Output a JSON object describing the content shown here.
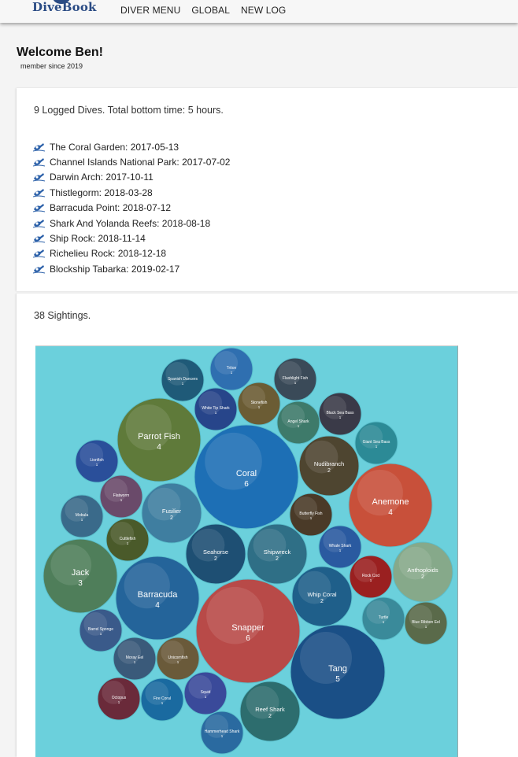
{
  "brand": {
    "name": "DiveBook"
  },
  "nav": {
    "items": [
      "DIVER MENU",
      "GLOBAL",
      "NEW LOG"
    ]
  },
  "welcome": {
    "title": "Welcome Ben!",
    "member_since": "member since 2019"
  },
  "dives": {
    "summary": "9 Logged Dives. Total bottom time: 5 hours.",
    "items": [
      "The Coral Garden: 2017-05-13",
      "Channel Islands National Park: 2017-07-02",
      "Darwin Arch: 2017-10-11",
      "Thistlegorm: 2018-03-28",
      "Barracuda Point: 2018-07-12",
      "Shark And Yolanda Reefs: 2018-08-18",
      "Ship Rock: 2018-11-14",
      "Richelieu Rock: 2018-12-18",
      "Blockship Tabarka: 2019-02-17"
    ]
  },
  "sightings": {
    "summary": "38 Sightings.",
    "background": "#6bd0dc",
    "bubbles": [
      {
        "name": "Coral",
        "count": 6,
        "color": "#1d6fb5"
      },
      {
        "name": "Snapper",
        "count": 6,
        "color": "#b84a48"
      },
      {
        "name": "Tang",
        "count": 5,
        "color": "#1a4f86"
      },
      {
        "name": "Parrot Fish",
        "count": 4,
        "color": "#5f7a3a"
      },
      {
        "name": "Barracuda",
        "count": 4,
        "color": "#24649a"
      },
      {
        "name": "Anemone",
        "count": 4,
        "color": "#c8503a"
      },
      {
        "name": "Jack",
        "count": 3,
        "color": "#4f7e5a"
      },
      {
        "name": "Fusilier",
        "count": 2,
        "color": "#3f7ea0"
      },
      {
        "name": "Nudibranch",
        "count": 2,
        "color": "#4e4530"
      },
      {
        "name": "Seahorse",
        "count": 2,
        "color": "#1e4f73"
      },
      {
        "name": "Shipwreck",
        "count": 2,
        "color": "#2f6f86"
      },
      {
        "name": "Whip Coral",
        "count": 2,
        "color": "#1f5f8a"
      },
      {
        "name": "Anthoploids",
        "count": 2,
        "color": "#86a98a"
      },
      {
        "name": "Reef Shark",
        "count": 2,
        "color": "#2d6d6e"
      },
      {
        "name": "Spanish Dancers",
        "count": 1,
        "color": "#1f5a78"
      },
      {
        "name": "Triton",
        "count": 1,
        "color": "#2f6fb0"
      },
      {
        "name": "Flashlight Fish",
        "count": 1,
        "color": "#3a4a58"
      },
      {
        "name": "White Tip Shark",
        "count": 1,
        "color": "#27458a"
      },
      {
        "name": "Stonefish",
        "count": 1,
        "color": "#6b5c34"
      },
      {
        "name": "Black Sea Bass",
        "count": 1,
        "color": "#3a3a48"
      },
      {
        "name": "Angel Shark",
        "count": 1,
        "color": "#3e7a6a"
      },
      {
        "name": "Giant Sea Bass",
        "count": 1,
        "color": "#2c8a96"
      },
      {
        "name": "Lionfish",
        "count": 1,
        "color": "#2a4f9a"
      },
      {
        "name": "Flatworm",
        "count": 1,
        "color": "#6a4a6a"
      },
      {
        "name": "Mobula",
        "count": 1,
        "color": "#3a6a8a"
      },
      {
        "name": "Cuttlefish",
        "count": 1,
        "color": "#4a5a2a"
      },
      {
        "name": "Butterfly Fish",
        "count": 1,
        "color": "#4a3a28"
      },
      {
        "name": "Whale Shark",
        "count": 1,
        "color": "#2a5aa0"
      },
      {
        "name": "Rock Cod",
        "count": 1,
        "color": "#9a2020"
      },
      {
        "name": "Turtle",
        "count": 1,
        "color": "#3a8a9a"
      },
      {
        "name": "Blue Ribbon Eel",
        "count": 1,
        "color": "#5a6a4a"
      },
      {
        "name": "Barrel Sponge",
        "count": 1,
        "color": "#3a5a8a"
      },
      {
        "name": "Moray Eel",
        "count": 1,
        "color": "#3a5a7a"
      },
      {
        "name": "Unicornfish",
        "count": 1,
        "color": "#6a5a3a"
      },
      {
        "name": "Octopus",
        "count": 1,
        "color": "#6a2a3a"
      },
      {
        "name": "Fire Coral",
        "count": 1,
        "color": "#1a6aa0"
      },
      {
        "name": "Squid",
        "count": 1,
        "color": "#3a4a9a"
      },
      {
        "name": "Hammerhead Shark",
        "count": 1,
        "color": "#2a6aa0"
      }
    ]
  }
}
